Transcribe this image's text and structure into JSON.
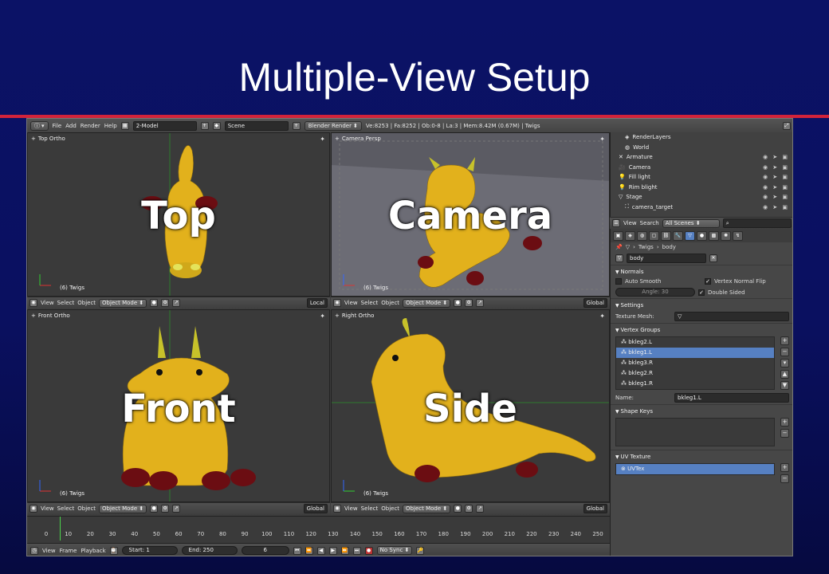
{
  "slide": {
    "title": "Multiple-View Setup"
  },
  "info_bar": {
    "menus": [
      "File",
      "Add",
      "Render",
      "Help"
    ],
    "layout_name": "2-Model",
    "scene_name": "Scene",
    "render_engine": "Blender Render",
    "stats": "Ve:8253 | Fa:8252 | Ob:0-8 | La:3 | Mem:8.42M (0.67M) | Twigs"
  },
  "viewports": {
    "top": {
      "view_label": "Top Ortho",
      "overlay": "Top",
      "object_label": "(6) Twigs",
      "orientation": "Local"
    },
    "camera": {
      "view_label": "Camera Persp",
      "overlay": "Camera",
      "object_label": "(6) Twigs",
      "orientation": "Global"
    },
    "front": {
      "view_label": "Front Ortho",
      "overlay": "Front",
      "object_label": "(6) Twigs",
      "orientation": "Global"
    },
    "side": {
      "view_label": "Right Ortho",
      "overlay": "Side",
      "object_label": "(6) Twigs",
      "orientation": "Global"
    }
  },
  "view_header": {
    "menus": [
      "View",
      "Select",
      "Object"
    ],
    "mode": "Object Mode"
  },
  "outliner": {
    "items": [
      {
        "label": "RenderLayers",
        "indent": 1
      },
      {
        "label": "World",
        "indent": 1
      },
      {
        "label": "Armature",
        "indent": 0
      },
      {
        "label": "Camera",
        "indent": 0
      },
      {
        "label": "Fill light",
        "indent": 0
      },
      {
        "label": "Rim blight",
        "indent": 0
      },
      {
        "label": "Stage",
        "indent": 0
      },
      {
        "label": "camera_target",
        "indent": 1
      }
    ],
    "header": {
      "menus": [
        "View",
        "Search"
      ],
      "filter": "All Scenes"
    }
  },
  "properties": {
    "breadcrumb": [
      "Twigs",
      "body"
    ],
    "mesh_name": "body",
    "normals": {
      "title": "Normals",
      "auto_smooth": "Auto Smooth",
      "angle": "Angle: 30",
      "vertex_normal_flip": "Vertex Normal Flip",
      "double_sided": "Double Sided"
    },
    "settings": {
      "title": "Settings",
      "texture_mesh_label": "Texture Mesh:"
    },
    "vertex_groups": {
      "title": "Vertex Groups",
      "items": [
        "bkleg2.L",
        "bkleg1.L",
        "bkleg3.R",
        "bkleg2.R",
        "bkleg1.R"
      ],
      "selected_index": 1,
      "name_label": "Name:",
      "name_value": "bkleg1.L"
    },
    "shape_keys": {
      "title": "Shape Keys"
    },
    "uv_texture": {
      "title": "UV Texture",
      "items": [
        "UVTex"
      ]
    }
  },
  "timeline": {
    "ticks": [
      "0",
      "10",
      "20",
      "30",
      "40",
      "50",
      "60",
      "70",
      "80",
      "90",
      "100",
      "110",
      "120",
      "130",
      "140",
      "150",
      "160",
      "170",
      "180",
      "190",
      "200",
      "210",
      "220",
      "230",
      "240",
      "250"
    ],
    "current_frame": 6,
    "header": {
      "menus": [
        "View",
        "Frame",
        "Playback"
      ],
      "start": "Start: 1",
      "end": "End: 250",
      "current": "6",
      "sync": "No Sync"
    }
  },
  "colors": {
    "slide_bg": "#0b1266",
    "rule": "#d2233a",
    "selection": "#5680c2",
    "model_yellow": "#e8b820",
    "model_dark_red": "#6b0d12"
  }
}
